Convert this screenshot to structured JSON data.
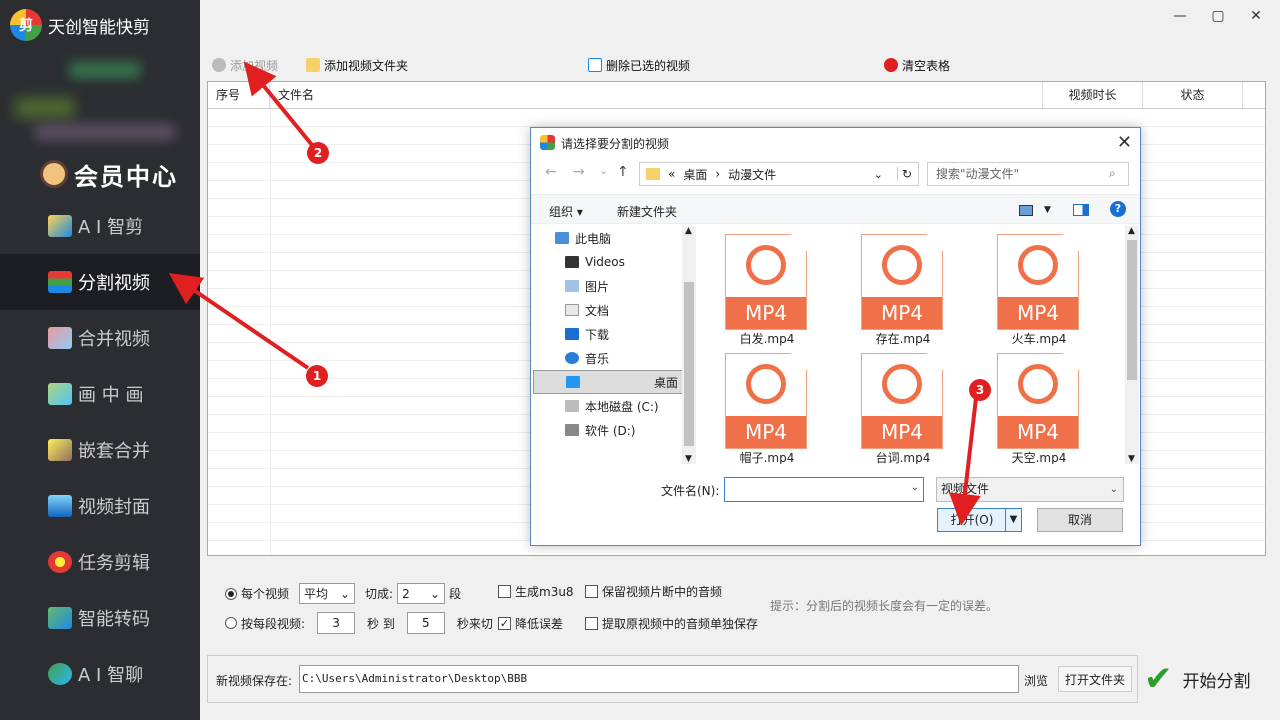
{
  "app": {
    "title": "天创智能快剪",
    "logo_text": "剪",
    "vip_label": "会员中心"
  },
  "sidebar": {
    "items": [
      {
        "label": "A I 智剪",
        "icon": "ai-cut-icon",
        "active": false
      },
      {
        "label": "分割视频",
        "icon": "split-video-icon",
        "active": true
      },
      {
        "label": "合并视频",
        "icon": "merge-video-icon",
        "active": false
      },
      {
        "label": "画 中 画",
        "icon": "picture-in-picture-icon",
        "active": false
      },
      {
        "label": "嵌套合并",
        "icon": "nest-merge-icon",
        "active": false
      },
      {
        "label": "视频封面",
        "icon": "video-cover-icon",
        "active": false
      },
      {
        "label": "任务剪辑",
        "icon": "task-edit-icon",
        "active": false
      },
      {
        "label": "智能转码",
        "icon": "transcode-icon",
        "active": false
      },
      {
        "label": "A I 智聊",
        "icon": "ai-chat-icon",
        "active": false
      }
    ]
  },
  "window": {
    "minimize": "—",
    "maximize": "▢",
    "close": "✕"
  },
  "toolbar": {
    "add_video": "添加视频",
    "add_folder": "添加视频文件夹",
    "delete_selected": "删除已选的视频",
    "clear_table": "清空表格"
  },
  "table": {
    "headers": [
      "序号",
      "文件名",
      "视频时长",
      "状态"
    ]
  },
  "options": {
    "per_video_label": "每个视频",
    "mode_value": "平均",
    "cut_into_label": "切成:",
    "segments_value": "2",
    "segments_unit": "段",
    "gen_m3u8": "生成m3u8",
    "keep_audio": "保留视频片断中的音频",
    "by_segment_label": "按每段视频:",
    "from_seconds": "3",
    "sec_to": "秒 到",
    "to_seconds": "5",
    "sec_cut": "秒来切",
    "reduce_error": "降低误差",
    "extract_audio": "提取原视频中的音频单独保存",
    "hint": "提示：分割后的视频长度会有一定的误差。"
  },
  "save": {
    "label": "新视频保存在:",
    "path": "C:\\Users\\Administrator\\Desktop\\BBB",
    "browse": "浏览",
    "open_folder": "打开文件夹",
    "start": "开始分割"
  },
  "dialog": {
    "title": "请选择要分割的视频",
    "close": "✕",
    "nav": {
      "back": "←",
      "forward": "→",
      "down": "⌄",
      "up": "↑",
      "refresh": "↻"
    },
    "path_sep": "«",
    "path": [
      "桌面",
      "动漫文件"
    ],
    "search_placeholder": "搜索\"动漫文件\"",
    "organize": "组织 ▾",
    "new_folder": "新建文件夹",
    "help": "?",
    "tree": [
      {
        "label": "此电脑",
        "icon": "computer-icon",
        "selected": false
      },
      {
        "label": "Videos",
        "icon": "videos-folder-icon",
        "selected": false
      },
      {
        "label": "图片",
        "icon": "pictures-folder-icon",
        "selected": false
      },
      {
        "label": "文档",
        "icon": "documents-folder-icon",
        "selected": false
      },
      {
        "label": "下载",
        "icon": "download-folder-icon",
        "selected": false
      },
      {
        "label": "音乐",
        "icon": "music-folder-icon",
        "selected": false
      },
      {
        "label": "桌面",
        "icon": "desktop-folder-icon",
        "selected": true
      },
      {
        "label": "本地磁盘 (C:)",
        "icon": "drive-c-icon",
        "selected": false
      },
      {
        "label": "软件 (D:)",
        "icon": "drive-d-icon",
        "selected": false
      }
    ],
    "file_badge": "MP4",
    "files": [
      "白发.mp4",
      "存在.mp4",
      "火车.mp4",
      "帽子.mp4",
      "台词.mp4",
      "天空.mp4"
    ],
    "filename_label": "文件名(N):",
    "filename_value": "",
    "filter": "视频文件",
    "open": "打开(O)",
    "cancel": "取消"
  },
  "annotations": [
    "1",
    "2",
    "3"
  ],
  "colors": {
    "sidebar_bg": "#2b2d31",
    "accent_red": "#e02020",
    "file_orange": "#f0704a"
  }
}
